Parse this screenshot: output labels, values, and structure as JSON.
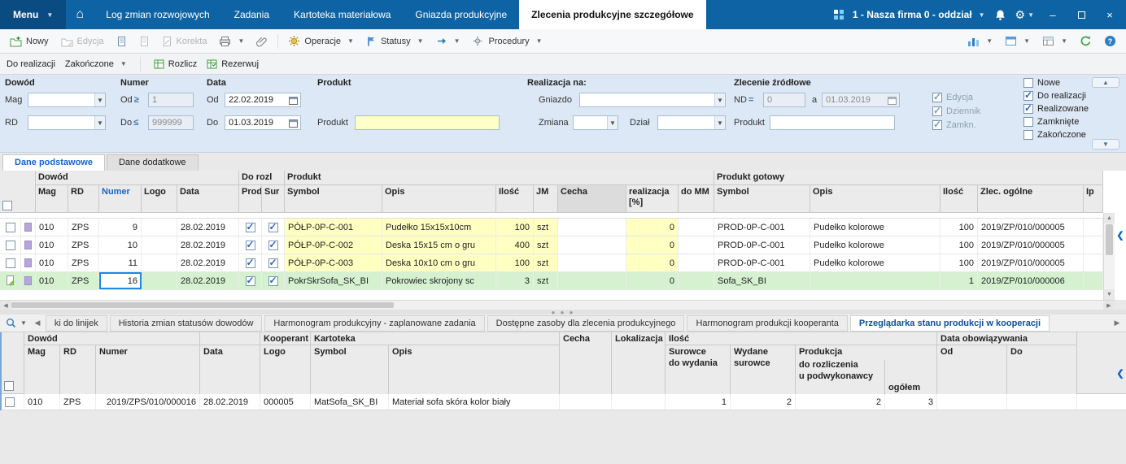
{
  "colors": {
    "topbar": "#0e63a5",
    "accent_blue": "#1464c8",
    "selected_row": "#d5f1d0",
    "cell_yellow": "#ffffc2",
    "indicator_purple": "#b6a6dc"
  },
  "titlebar": {
    "menu": "Menu",
    "tabs": [
      "Log zmian rozwojowych",
      "Zadania",
      "Kartoteka materiałowa",
      "Gniazda produkcyjne",
      "Zlecenia produkcyjne szczegółowe"
    ],
    "active_tab_index": 4,
    "company": "1 - Nasza firma 0 - oddział"
  },
  "toolbar": {
    "nowy": "Nowy",
    "edycja": "Edycja",
    "korekta": "Korekta",
    "operacje": "Operacje",
    "statusy": "Statusy",
    "procedury": "Procedury"
  },
  "quickbar": {
    "do_realizacji": "Do realizacji",
    "zakonczone": "Zakończone",
    "rozlicz": "Rozlicz",
    "rezerwuj": "Rezerwuj"
  },
  "filters": {
    "dowod": {
      "label": "Dowód",
      "mag": "Mag",
      "rd": "RD"
    },
    "numer": {
      "label": "Numer",
      "od": "Od",
      "od_op": "≥",
      "od_value": "1",
      "do": "Do",
      "do_op": "≤",
      "do_value": "999999"
    },
    "data": {
      "label": "Data",
      "od": "Od",
      "od_value": "22.02.2019",
      "do": "Do",
      "do_value": "01.03.2019"
    },
    "produkt": {
      "label": "Produkt",
      "field_label": "Produkt",
      "value": ""
    },
    "realizacja": {
      "label": "Realizacja na:",
      "gniazdo": "Gniazdo",
      "zmiana": "Zmiana",
      "dzial": "Dział"
    },
    "zrodlowe": {
      "label": "Zlecenie źródłowe",
      "nd": "ND",
      "nd_op": "=",
      "nd_value": "0",
      "a": "a",
      "a_value": "01.03.2019",
      "produkt": "Produkt",
      "produkt_value": ""
    },
    "flags_disabled": [
      {
        "label": "Edycja",
        "checked": true
      },
      {
        "label": "Dziennik",
        "checked": true
      },
      {
        "label": "Zamkn.",
        "checked": true
      }
    ],
    "flags": [
      {
        "label": "Nowe",
        "checked": false
      },
      {
        "label": "Do realizacji",
        "checked": true
      },
      {
        "label": "Realizowane",
        "checked": true
      },
      {
        "label": "Zamknięte",
        "checked": false
      },
      {
        "label": "Zakończone",
        "checked": false
      }
    ]
  },
  "maintabs": {
    "items": [
      "Dane podstawowe",
      "Dane dodatkowe"
    ],
    "active_index": 0
  },
  "grid": {
    "groups": [
      {
        "label": "Dowód"
      },
      {
        "label": "Do rozl"
      },
      {
        "label": "Produkt"
      },
      {
        "label": "Produkt gotowy"
      }
    ],
    "columns": [
      "Mag",
      "RD",
      "Numer",
      "Logo",
      "Data",
      "Prod",
      "Sur",
      "Symbol",
      "Opis",
      "Ilość",
      "JM",
      "Cecha",
      "realizacja [%]",
      "do MM",
      "Symbol",
      "Opis",
      "Ilość",
      "Zlec. ogólne",
      "Ip"
    ],
    "rows": [
      {
        "mag": "010",
        "rd": "ZPS",
        "numer": "9",
        "logo": "",
        "data": "28.02.2019",
        "prod": true,
        "sur": true,
        "symbol": "PÓŁP-0P-C-001",
        "opis": "Pudełko 15x15x10cm",
        "ilosc": "100",
        "jm": "szt",
        "cecha": "",
        "realizacja": "0",
        "do_mm": "",
        "symbol2": "PROD-0P-C-001",
        "opis2": "Pudełko kolorowe",
        "ilosc2": "100",
        "zlec": "2019/ZP/010/000005",
        "ip": ""
      },
      {
        "mag": "010",
        "rd": "ZPS",
        "numer": "10",
        "logo": "",
        "data": "28.02.2019",
        "prod": true,
        "sur": true,
        "symbol": "PÓŁP-0P-C-002",
        "opis": "Deska 15x15 cm o gru",
        "ilosc": "400",
        "jm": "szt",
        "cecha": "",
        "realizacja": "0",
        "do_mm": "",
        "symbol2": "PROD-0P-C-001",
        "opis2": "Pudełko kolorowe",
        "ilosc2": "100",
        "zlec": "2019/ZP/010/000005",
        "ip": ""
      },
      {
        "mag": "010",
        "rd": "ZPS",
        "numer": "11",
        "logo": "",
        "data": "28.02.2019",
        "prod": true,
        "sur": true,
        "symbol": "PÓŁP-0P-C-003",
        "opis": "Deska 10x10 cm o gru",
        "ilosc": "100",
        "jm": "szt",
        "cecha": "",
        "realizacja": "0",
        "do_mm": "",
        "symbol2": "PROD-0P-C-001",
        "opis2": "Pudełko kolorowe",
        "ilosc2": "100",
        "zlec": "2019/ZP/010/000005",
        "ip": ""
      },
      {
        "selected": true,
        "mag": "010",
        "rd": "ZPS",
        "numer": "16",
        "logo": "",
        "data": "28.02.2019",
        "prod": true,
        "sur": true,
        "symbol": "PokrSkrSofa_SK_BI",
        "opis": "Pokrowiec skrojony sc",
        "ilosc": "3",
        "jm": "szt",
        "cecha": "",
        "realizacja": "0",
        "do_mm": "",
        "symbol2": "Sofa_SK_BI",
        "opis2": "",
        "ilosc2": "1",
        "zlec": "2019/ZP/010/000006",
        "ip": ""
      }
    ]
  },
  "bottom": {
    "tabs": [
      "ki do linijek",
      "Historia zmian statusów dowodów",
      "Harmonogram produkcyjny - zaplanowane zadania",
      "Dostępne zasoby dla zlecenia produkcyjnego",
      "Harmonogram produkcji kooperanta",
      "Przeglądarka stanu produkcji w kooperacji"
    ],
    "active_index": 5,
    "header": {
      "dowod": "Dowód",
      "mag": "Mag",
      "rd": "RD",
      "numer": "Numer",
      "data": "Data",
      "kooperant": "Kooperant",
      "logo": "Logo",
      "kartoteka": "Kartoteka",
      "symbol": "Symbol",
      "opis": "Opis",
      "cecha": "Cecha",
      "lokalizacja": "Lokalizacja",
      "ilosc": "Ilość",
      "surowce1": "Surowce",
      "surowce2": "do wydania",
      "wydane1": "Wydane",
      "wydane2": "surowce",
      "produkcja": "Produkcja",
      "rozliczenia": "do rozliczenia",
      "podwykonawcy": "u podwykonawcy",
      "ogolem": "ogółem",
      "data_obw": "Data obowiązywania",
      "od": "Od",
      "do": "Do"
    },
    "row": {
      "mag": "010",
      "rd": "ZPS",
      "numer": "2019/ZPS/010/000016",
      "data": "28.02.2019",
      "logo": "000005",
      "symbol": "MatSofa_SK_BI",
      "opis": "Materiał sofa skóra kolor biały",
      "cecha": "",
      "lokalizacja": "",
      "surowce": "1",
      "wydane": "2",
      "rozliczenia": "2",
      "ogolem": "3",
      "od": "",
      "do": ""
    }
  }
}
